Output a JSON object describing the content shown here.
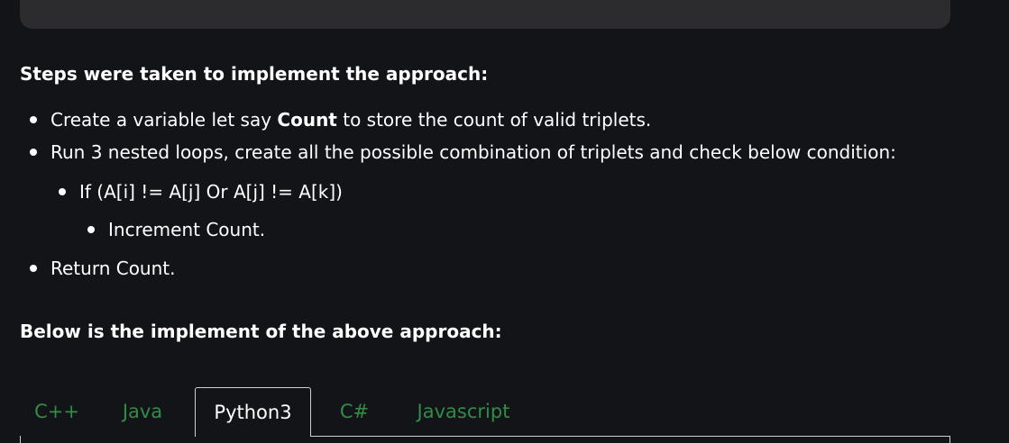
{
  "content": {
    "steps_heading": "Steps were taken to implement the approach:",
    "steps": {
      "step1_pre": "Create a variable let say ",
      "step1_bold": "Count",
      "step1_post": " to store the count of valid triplets.",
      "step2": "Run 3 nested loops, create all the possible combination of triplets and check below condition:",
      "step2_sub": "If (A[i] != A[j] Or A[j] != A[k])",
      "step2_sub_sub": "Increment Count.",
      "step3": "Return Count."
    },
    "below_heading": "Below is the implement of the above approach:"
  },
  "tabs": {
    "items": [
      {
        "label": "C++"
      },
      {
        "label": "Java"
      },
      {
        "label": "Python3"
      },
      {
        "label": "C#"
      },
      {
        "label": "Javascript"
      }
    ],
    "active": "Python3"
  },
  "colors": {
    "background": "#131417",
    "code_block": "#2c2c2e",
    "tab_link": "#2f8d46",
    "text": "#ffffff"
  }
}
